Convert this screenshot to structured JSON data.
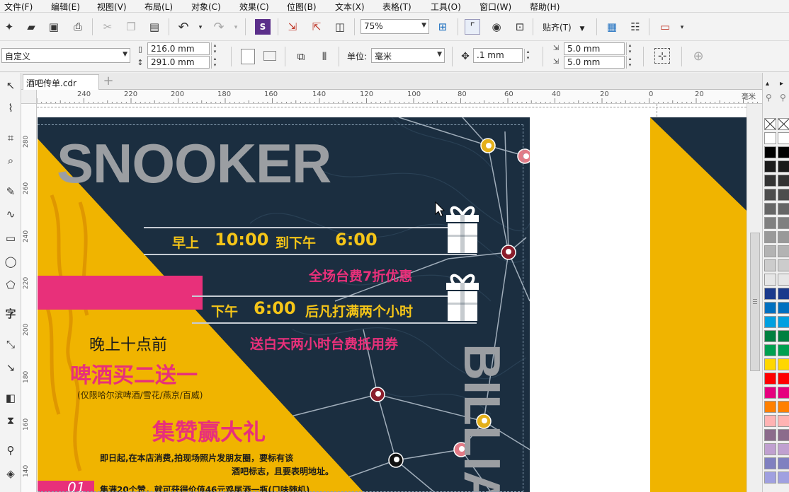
{
  "menu": [
    "文件(F)",
    "编辑(E)",
    "视图(V)",
    "布局(L)",
    "对象(C)",
    "效果(C)",
    "位图(B)",
    "文本(X)",
    "表格(T)",
    "工具(O)",
    "窗口(W)",
    "帮助(H)"
  ],
  "toolbar": {
    "zoom_value": "75%",
    "snap_label": "贴齐(T)"
  },
  "propbar": {
    "page_preset": "自定义",
    "width": "216.0 mm",
    "height": "291.0 mm",
    "unit_label": "单位:",
    "unit_value": "毫米",
    "nudge": ".1 mm",
    "dup_x": "5.0 mm",
    "dup_y": "5.0 mm"
  },
  "tabs": {
    "doc": "酒吧传单.cdr"
  },
  "hruler": {
    "labels": [
      "240",
      "220",
      "200",
      "180",
      "160",
      "140",
      "120",
      "100",
      "80",
      "60",
      "40",
      "20",
      "0",
      "20"
    ],
    "unit": "毫米"
  },
  "vruler": {
    "labels": [
      "280",
      "260",
      "240",
      "220",
      "200",
      "180",
      "160",
      "140"
    ]
  },
  "flyer": {
    "title": "SNOOKER",
    "side_title": "BILLIA",
    "line1_a": "早上",
    "line1_b": "10:00",
    "line1_c": "到下午",
    "line1_d": "6:00",
    "promo1": "全场台费7折优惠",
    "line2_a": "下午",
    "line2_b": "6:00",
    "line2_c": "后凡打满两个小时",
    "promo2": "送白天两小时台费抵用券",
    "left1": "晚上十点前",
    "left2": "啤酒买二送一",
    "left3": "(仅限哈尔滨啤酒/雪花/燕京/百威)",
    "left4": "集赞赢大礼",
    "left5": "即日起,在本店消费,拍现场照片发朋友圈，要标有该",
    "left6": "酒吧标志，且要表明地址。",
    "badge": "01",
    "bottom": "集满20个赞，就可获得价值46元鸡尾酒一瓶(口味随机)"
  },
  "colors": {
    "navy": "#1b2e40",
    "yellow": "#f0b400",
    "pink": "#e8307a",
    "white": "#ffffff"
  },
  "palette": [
    "#ffffff",
    "#000000",
    "#1a1a1a",
    "#333333",
    "#4d4d4d",
    "#666666",
    "#808080",
    "#999999",
    "#b3b3b3",
    "#cccccc",
    "#e6e6e6",
    "#1a3a8c",
    "#0070c0",
    "#00a0e0",
    "#008040",
    "#00a050",
    "#ffd700",
    "#ff0000",
    "#e6007e",
    "#ff8000",
    "#ffb3b3",
    "#8c6b8c",
    "#c0a0d0",
    "#8080c0",
    "#a0a0e0"
  ]
}
